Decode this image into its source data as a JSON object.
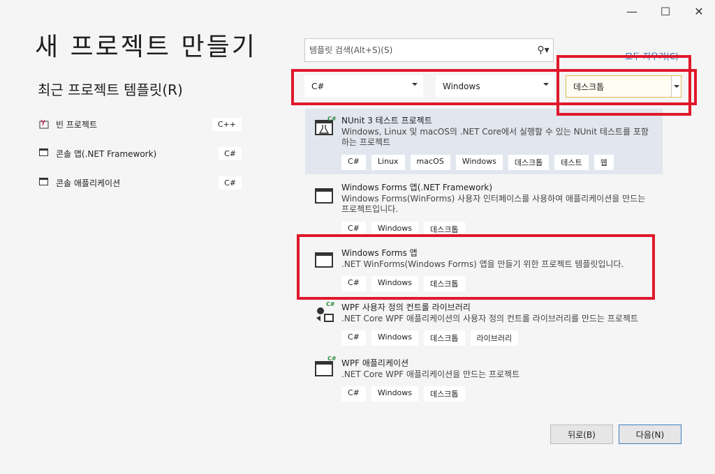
{
  "window": {
    "minimize": "—",
    "maximize": "☐",
    "close": "✕"
  },
  "page_title": "새 프로젝트 만들기",
  "recent": {
    "title": "최근 프로젝트 템플릿(R)",
    "items": [
      {
        "label": "빈 프로젝트",
        "lang": "C++"
      },
      {
        "label": "콘솔 앱(.NET Framework)",
        "lang": "C#"
      },
      {
        "label": "콘솔 애플리케이션",
        "lang": "C#"
      }
    ]
  },
  "search": {
    "placeholder": "템플릿 검색(Alt+S)(S)",
    "icon": "search-icon"
  },
  "clear_all": "모두 지우기(C)",
  "filters": {
    "language": "C#",
    "platform": "Windows",
    "project_type": "데스크톱"
  },
  "templates": [
    {
      "title": "NUnit 3 테스트 프로젝트",
      "desc": "Windows, Linux 및 macOS의 .NET Core에서 실행할 수 있는 NUnit 테스트를 포함하는 프로젝트",
      "tags": [
        "C#",
        "Linux",
        "macOS",
        "Windows",
        "데스크톱",
        "테스트",
        "웹"
      ]
    },
    {
      "title": "Windows Forms 앱(.NET Framework)",
      "desc": "Windows Forms(WinForms) 사용자 인터페이스를 사용하여 애플리케이션을 만드는 프로젝트입니다.",
      "tags": [
        "C#",
        "Windows",
        "데스크톱"
      ]
    },
    {
      "title": "Windows Forms 앱",
      "desc": ".NET WinForms(Windows Forms) 앱을 만들기 위한 프로젝트 템플릿입니다.",
      "tags": [
        "C#",
        "Windows",
        "데스크톱"
      ]
    },
    {
      "title": "WPF 사용자 정의 컨트롤 라이브러리",
      "desc": ".NET Core WPF 애플리케이션의 사용자 정의 컨트롤 라이브러리를 만드는 프로젝트",
      "tags": [
        "C#",
        "Windows",
        "데스크톱",
        "라이브러리"
      ]
    },
    {
      "title": "WPF 애플리케이션",
      "desc": ".NET Core WPF 애플리케이션을 만드는 프로젝트",
      "tags": [
        "C#",
        "Windows",
        "데스크톱"
      ]
    }
  ],
  "buttons": {
    "back": "뒤로(B)",
    "next": "다음(N)"
  },
  "colors": {
    "highlight": "#e0182a",
    "selected_bg": "#e2e6ee",
    "link": "#1a5ea8"
  }
}
